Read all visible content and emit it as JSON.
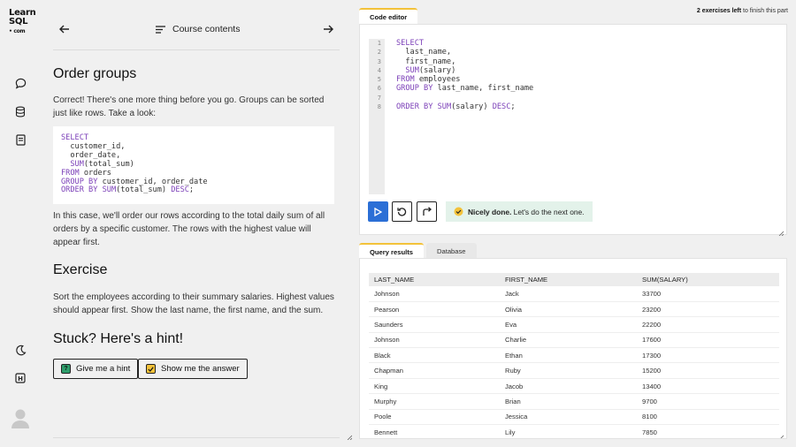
{
  "logo": {
    "line1": "Learn",
    "line2": "SQL",
    "line3": "• com"
  },
  "rail": {
    "icons": [
      "chat-icon",
      "database-icon",
      "notes-icon",
      "moon-icon",
      "help-icon",
      "avatar"
    ]
  },
  "lesson": {
    "contents_label": "Course contents",
    "title": "Order groups",
    "intro": "Correct! There's one more thing before you go. Groups can be sorted just like rows. Take a look:",
    "code_lines": [
      "SELECT",
      "  customer_id,",
      "  order_date,",
      "  SUM(total_sum)",
      "FROM orders",
      "GROUP BY customer_id, order_date",
      "ORDER BY SUM(total_sum) DESC;"
    ],
    "explanation": "In this case, we'll order our rows according to the total daily sum of all orders by a specific customer. The rows with the highest value will appear first.",
    "exercise_title": "Exercise",
    "exercise_text": "Sort the employees according to their summary salaries. Highest values should appear first. Show the last name, the first name, and the sum.",
    "hint_title": "Stuck? Here's a hint!",
    "hint_button": "Give me a hint",
    "answer_button": "Show me the answer"
  },
  "top_note": {
    "bold": "2 exercises left",
    "rest": " to finish this part"
  },
  "editor": {
    "tab_label": "Code editor",
    "line_numbers": [
      "1",
      "2",
      "3",
      "4",
      "5",
      "6",
      "7",
      "8"
    ],
    "code_lines": [
      "SELECT",
      "  last_name,",
      "  first_name,",
      "  SUM(salary)",
      "FROM employees",
      "GROUP BY last_name, first_name",
      "",
      "ORDER BY SUM(salary) DESC;"
    ],
    "toast_bold": "Nicely done.",
    "toast_rest": " Let's do the next one."
  },
  "results": {
    "tabs": [
      "Query results",
      "Database"
    ],
    "columns": [
      "LAST_NAME",
      "FIRST_NAME",
      "SUM(SALARY)"
    ],
    "rows": [
      [
        "Johnson",
        "Jack",
        "33700"
      ],
      [
        "Pearson",
        "Olivia",
        "23200"
      ],
      [
        "Saunders",
        "Eva",
        "22200"
      ],
      [
        "Johnson",
        "Charlie",
        "17600"
      ],
      [
        "Black",
        "Ethan",
        "17300"
      ],
      [
        "Chapman",
        "Ruby",
        "15200"
      ],
      [
        "King",
        "Jacob",
        "13400"
      ],
      [
        "Murphy",
        "Brian",
        "9700"
      ],
      [
        "Poole",
        "Jessica",
        "8100"
      ],
      [
        "Bennett",
        "Lily",
        "7850"
      ]
    ]
  },
  "colors": {
    "accent": "#2b6fd6",
    "tab_highlight": "#f3c23a",
    "keyword": "#7b3fb8",
    "toast_bg": "#e3f2ea"
  }
}
